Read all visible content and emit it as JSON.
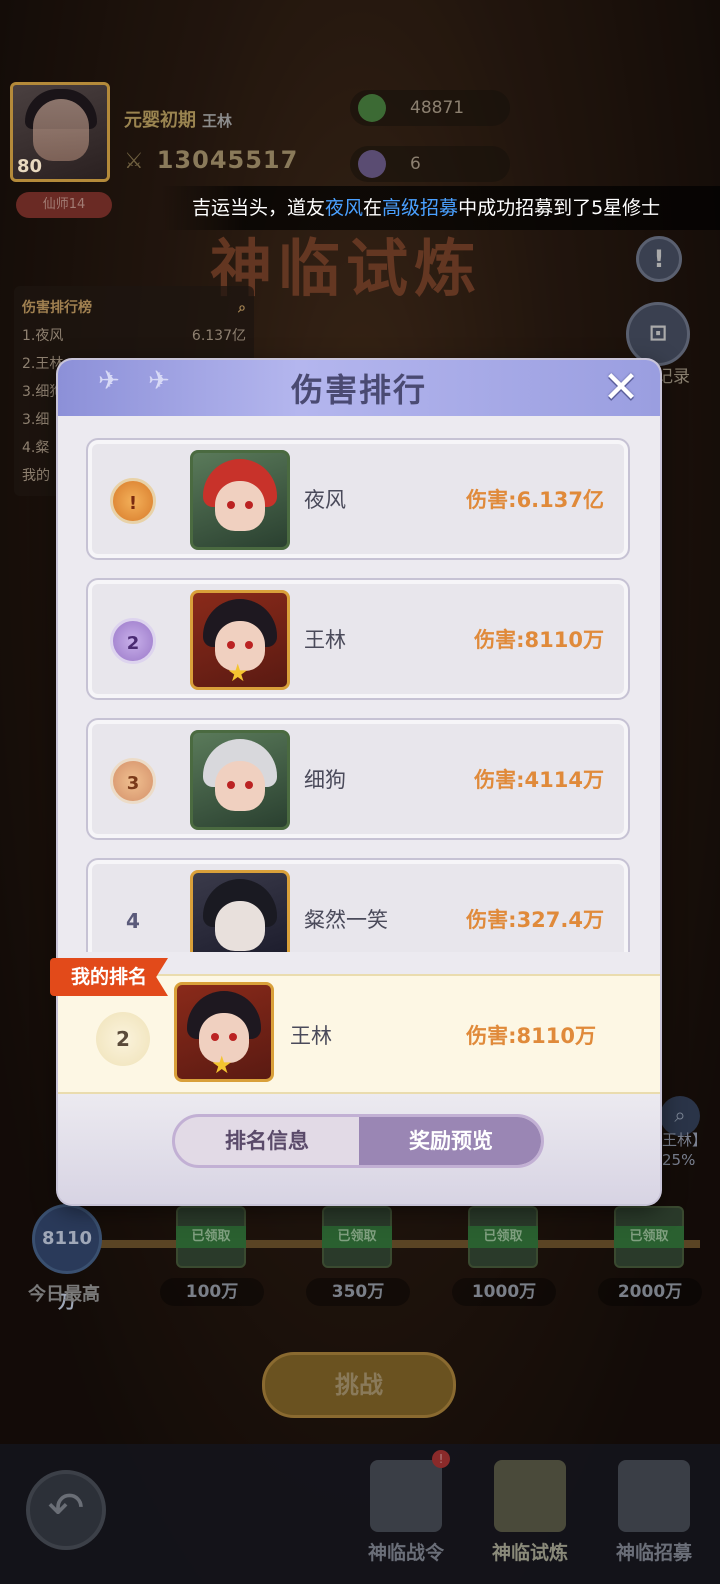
{
  "player": {
    "level": "80",
    "realm": "元婴初期",
    "name": "王林",
    "power": "13045517",
    "title_badge": "仙师14"
  },
  "resources": [
    {
      "icon": "jade-icon",
      "value": "48871"
    },
    {
      "icon": "crystal-icon",
      "value": "6"
    }
  ],
  "marquee": {
    "prefix": "吉运当头，道友",
    "player": "夜风",
    "mid": "在",
    "event": "高级招募",
    "suffix": "中成功招募到了5星修士"
  },
  "background": {
    "trial_title": "神临试炼",
    "rank_panel_title": "伤害排行榜",
    "rank_panel_rows": [
      {
        "label": "1.夜风",
        "value": "6.137亿"
      },
      {
        "label": "2.王林",
        "value": ""
      },
      {
        "label": "3.细狗",
        "value": ""
      },
      {
        "label": "3.细",
        "value": ""
      },
      {
        "label": "4.粲",
        "value": ""
      },
      {
        "label": "我的",
        "value": ""
      }
    ],
    "record_label": "记录",
    "side_text_1": "王林】",
    "side_text_2": "25%"
  },
  "milestones": {
    "today_value": "8110万",
    "today_label": "今日最高",
    "claimed_label": "已领取",
    "thresholds": [
      "100万",
      "350万",
      "1000万",
      "2000万"
    ]
  },
  "challenge_label": "挑战",
  "bottom_nav": {
    "badge": "!",
    "tabs": [
      "神临战令",
      "神临试炼",
      "神临招募"
    ],
    "active_index": 1
  },
  "modal": {
    "title": "伤害排行",
    "damage_prefix": "伤害:",
    "ranks": [
      {
        "rank": "1",
        "name": "夜风",
        "damage": "6.137亿",
        "medal": "gold"
      },
      {
        "rank": "2",
        "name": "王林",
        "damage": "8110万",
        "medal": "purple"
      },
      {
        "rank": "3",
        "name": "细狗",
        "damage": "4114万",
        "medal": "bronze"
      },
      {
        "rank": "4",
        "name": "粲然一笑",
        "damage": "327.4万",
        "medal": "none"
      }
    ],
    "my_rank": {
      "tag": "我的排名",
      "rank": "2",
      "name": "王林",
      "damage": "8110万"
    },
    "tabs": [
      "排名信息",
      "奖励预览"
    ],
    "active_tab": 1
  }
}
